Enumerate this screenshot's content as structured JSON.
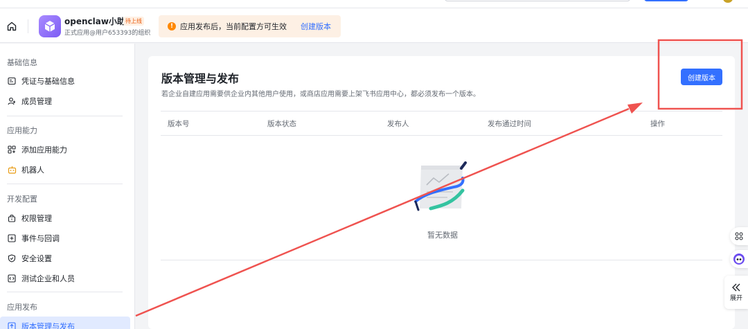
{
  "header": {
    "app_name": "openclaw小助理",
    "app_badge": "待上线",
    "app_sub": "正式应用@用户653393的组织",
    "notice_text": "应用发布后，当前配置方可生效",
    "notice_link": "创建版本"
  },
  "sidebar": {
    "sections": [
      {
        "title": "基础信息",
        "items": [
          {
            "label": "凭证与基础信息",
            "icon": "credential-icon"
          },
          {
            "label": "成员管理",
            "icon": "member-icon"
          }
        ]
      },
      {
        "title": "应用能力",
        "items": [
          {
            "label": "添加应用能力",
            "icon": "add-capability-icon"
          },
          {
            "label": "机器人",
            "icon": "robot-icon"
          }
        ]
      },
      {
        "title": "开发配置",
        "items": [
          {
            "label": "权限管理",
            "icon": "lock-icon"
          },
          {
            "label": "事件与回调",
            "icon": "event-icon"
          },
          {
            "label": "安全设置",
            "icon": "shield-icon"
          },
          {
            "label": "测试企业和人员",
            "icon": "code-icon"
          }
        ]
      },
      {
        "title": "应用发布",
        "items": [
          {
            "label": "版本管理与发布",
            "icon": "upload-icon",
            "active": true
          }
        ]
      }
    ]
  },
  "main": {
    "title": "版本管理与发布",
    "description": "若企业自建应用需要供企业内其他用户使用，或商店应用需要上架飞书应用中心，都必须发布一个版本。",
    "create_button": "创建版本",
    "columns": [
      "版本号",
      "版本状态",
      "发布人",
      "发布通过时间",
      "操作"
    ],
    "empty_text": "暂无数据"
  },
  "floating": {
    "expand_label": "展开"
  },
  "colors": {
    "accent": "#3370ff",
    "annotation": "#ef5350",
    "notice_bg": "#fdf0e4",
    "notice_icon": "#ff8800"
  }
}
